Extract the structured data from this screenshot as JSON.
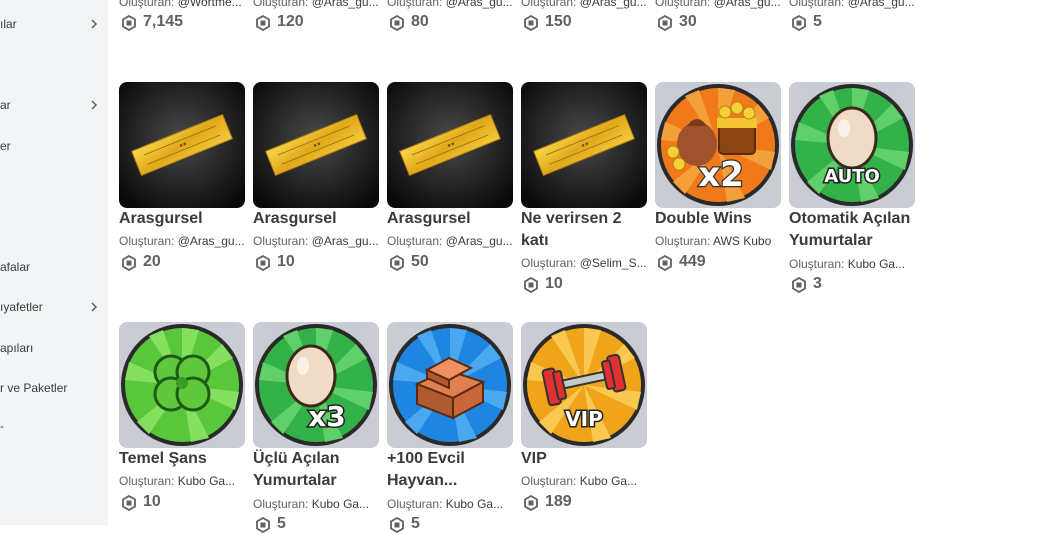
{
  "sidebar": {
    "items": [
      {
        "label": "ılar",
        "chevron": true
      },
      {
        "label": "ar",
        "chevron": true
      },
      {
        "label": "er",
        "chevron": false
      },
      {
        "label": "afalar",
        "chevron": false
      },
      {
        "label": "ıyafetler",
        "chevron": true
      },
      {
        "label": "apıları",
        "chevron": false
      },
      {
        "label": "r ve Paketler",
        "chevron": false
      },
      {
        "label": "-",
        "chevron": false
      }
    ]
  },
  "creator_prefix": "Oluşturan: ",
  "top_row": [
    {
      "creator": "@Wortme...",
      "price": "7,145"
    },
    {
      "creator": "@Aras_gu...",
      "price": "120"
    },
    {
      "creator": "@Aras_gu...",
      "price": "80"
    },
    {
      "creator": "@Aras_gu...",
      "price": "150"
    },
    {
      "creator": "@Aras_gu...",
      "price": "30"
    },
    {
      "creator": "@Aras_gu...",
      "price": "5"
    }
  ],
  "row2": [
    {
      "name": "Arasgursel",
      "creator": "@Aras_gu...",
      "price": "20",
      "icon": "golden-ticket-icon"
    },
    {
      "name": "Arasgursel",
      "creator": "@Aras_gu...",
      "price": "10",
      "icon": "golden-ticket-icon"
    },
    {
      "name": "Arasgursel",
      "creator": "@Aras_gu...",
      "price": "50",
      "icon": "golden-ticket-icon"
    },
    {
      "name": "Ne verirsen 2 katı",
      "creator": "@Selim_S...",
      "price": "10",
      "icon": "golden-ticket-icon"
    },
    {
      "name": "Double Wins",
      "creator": "AWS Kubo",
      "price": "449",
      "icon": "treasure-x2-icon"
    },
    {
      "name": "Otomatik Açılan Yumurtalar",
      "creator": "Kubo Ga...",
      "price": "3",
      "icon": "auto-egg-icon"
    }
  ],
  "row3": [
    {
      "name": "Temel Şans",
      "creator": "Kubo Ga...",
      "price": "10",
      "icon": "clover-icon"
    },
    {
      "name": "Üçlü Açılan Yumurtalar",
      "creator": "Kubo Ga...",
      "price": "5",
      "icon": "egg-x3-icon"
    },
    {
      "name": "+100 Evcil Hayvan...",
      "creator": "Kubo Ga...",
      "price": "5",
      "icon": "crates-icon"
    },
    {
      "name": "VIP",
      "creator": "Kubo Ga...",
      "price": "189",
      "icon": "vip-dumbbell-icon"
    }
  ],
  "labels": {
    "vip_badge": "VIP",
    "auto_badge": "AUTO",
    "x2_badge": "x2",
    "x3_badge": "x3"
  },
  "colors": {
    "text": "#393b3d",
    "muted": "#606162",
    "sidebar_bg": "#f2f4f5",
    "thumb_bg": "#c9ccd2"
  }
}
